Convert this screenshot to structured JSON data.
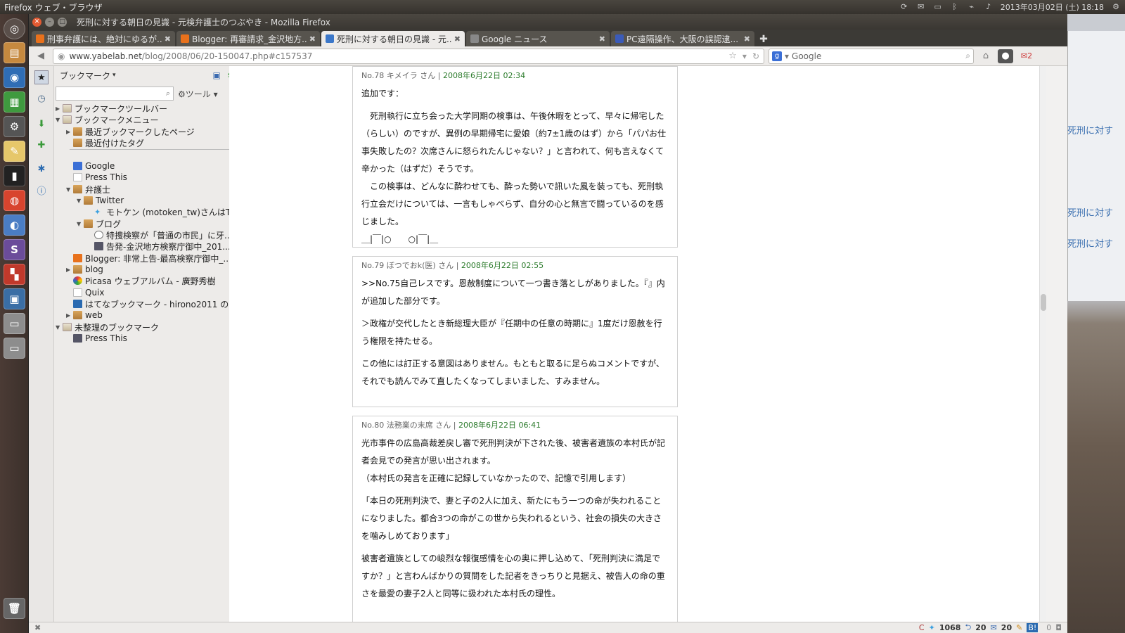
{
  "topbar": {
    "app_name": "Firefox ウェブ・ブラウザ",
    "datetime": "2013年03月02日 (土) 18:18"
  },
  "window": {
    "title": "死刑に対する朝日の見識 - 元検弁護士のつぶやき - Mozilla Firefox"
  },
  "tabs": [
    {
      "label": "刑事弁護には、絶対にゆるが...",
      "favicon_color": "#e8711c",
      "active": false
    },
    {
      "label": "Blogger: 再審請求_金沢地方...",
      "favicon_color": "#e8711c",
      "active": false
    },
    {
      "label": "死刑に対する朝日の見識 - 元...",
      "favicon_color": "#3b77c9",
      "active": true
    },
    {
      "label": "Google ニュース",
      "favicon_color": "#888888",
      "active": false
    },
    {
      "label": "PC遠隔操作、大阪の誤認逮...",
      "favicon_color": "#3b5bb9",
      "active": false
    }
  ],
  "navbar": {
    "url_site": "www.yabelab.net",
    "url_path": "/blog/2008/06/20-150047.php#c157537",
    "search_placeholder": "Google",
    "badge": "2"
  },
  "sidebar": {
    "title": "ブックマーク",
    "tools_label": "ツール",
    "tree": [
      {
        "label": "ブックマークツールバー",
        "indent": 0,
        "arrow": "▶",
        "icon": "folder-special"
      },
      {
        "label": "ブックマークメニュー",
        "indent": 0,
        "arrow": "▼",
        "icon": "folder-special"
      },
      {
        "label": "最近ブックマークしたページ",
        "indent": 1,
        "arrow": "▶",
        "icon": "folder"
      },
      {
        "label": "最近付けたタグ",
        "indent": 1,
        "arrow": "",
        "icon": "folder"
      },
      {
        "label": "Google",
        "indent": 1,
        "arrow": "",
        "icon": "google"
      },
      {
        "label": "Press This",
        "indent": 1,
        "arrow": "",
        "icon": "page"
      },
      {
        "label": "弁護士",
        "indent": 1,
        "arrow": "▼",
        "icon": "folder"
      },
      {
        "label": "Twitter",
        "indent": 2,
        "arrow": "▼",
        "icon": "folder"
      },
      {
        "label": "モトケン (motoken_tw)さんはT...",
        "indent": 3,
        "arrow": "",
        "icon": "twitter"
      },
      {
        "label": "ブログ",
        "indent": 2,
        "arrow": "▼",
        "icon": "folder"
      },
      {
        "label": "特捜検察が「普通の市民」に牙...",
        "indent": 3,
        "arrow": "",
        "icon": "wordpress"
      },
      {
        "label": "告発-金沢地方検察庁御中_201...",
        "indent": 3,
        "arrow": "",
        "icon": "image"
      },
      {
        "label": "Blogger: 非常上告-最高検察庁御中_...",
        "indent": 1,
        "arrow": "",
        "icon": "blogger"
      },
      {
        "label": "blog",
        "indent": 1,
        "arrow": "▶",
        "icon": "folder"
      },
      {
        "label": "Picasa ウェブアルバム - 廣野秀樹",
        "indent": 1,
        "arrow": "",
        "icon": "picasa"
      },
      {
        "label": "Quix",
        "indent": 1,
        "arrow": "",
        "icon": "page"
      },
      {
        "label": "はてなブックマーク - hirono2011 のブ...",
        "indent": 1,
        "arrow": "",
        "icon": "hatena"
      },
      {
        "label": "web",
        "indent": 1,
        "arrow": "▶",
        "icon": "folder"
      },
      {
        "label": "未整理のブックマーク",
        "indent": 0,
        "arrow": "▼",
        "icon": "folder-special"
      },
      {
        "label": "Press This",
        "indent": 1,
        "arrow": "",
        "icon": "image"
      }
    ]
  },
  "comments": [
    {
      "header": "No.78 キメイラ さん |",
      "date": "2008年6月22日 02:34",
      "paragraphs": [
        "追加です：",
        "　死刑執行に立ち会った大学同期の検事は、午後休暇をとって、早々に帰宅した（らしい）のですが、異例の早期帰宅に愛娘（約7±1歳のはず）から「パパお仕事失敗したの？次席さんに怒られたんじゃない？」と言われて、何も言えなくて辛かった（はずだ）そうです。",
        "　この検事は、どんなに酔わせても、酔った勢いで訊いた風を装っても、死刑執行立会だけについては、一言もしゃべらず、自分の心と無言で闘っているのを感じました。",
        "＿|￣|○　　○|￣|＿"
      ]
    },
    {
      "header": "No.79 ぼつでおk(医) さん |",
      "date": "2008年6月22日 02:55",
      "paragraphs": [
        ">>No.75自己レスです。恩赦制度について一つ書き落としがありました。『』内が追加した部分です。",
        "＞政権が交代したとき新総理大臣が『任期中の任意の時期に』1度だけ恩赦を行う権限を持たせる。",
        "この他には訂正する意図はありません。もともと取るに足らぬコメントですが、それでも読んでみて直したくなってしまいました、すみません。"
      ]
    },
    {
      "header": "No.80 法務業の末席 さん |",
      "date": "2008年6月22日 06:41",
      "paragraphs": [
        "光市事件の広島高裁差戻し審で死刑判決が下された後、被害者遺族の本村氏が記者会見での発言が思い出されます。\n（本村氏の発言を正確に記録していなかったので、記憶で引用します）",
        "「本日の死刑判決で、妻と子の2人に加え、新たにもう一つの命が失われることになりました。都合3つの命がこの世から失われるという、社会の損失の大きさを噛みしめております」",
        "被害者遺族としての峻烈な報復感情を心の奥に押し込めて、「死刑判決に満足ですか？」と言わんばかりの質問をした記者をきっちりと見据え、被告人の命の重さを最愛の妻子2人と同等に扱われた本村氏の理性。"
      ]
    }
  ],
  "statusbar": {
    "count1": "1068",
    "count2": "20",
    "count3": "20",
    "count4": "0"
  },
  "background_window": {
    "snippets": [
      "死刑に対す",
      "死刑に対す",
      "死刑に対す"
    ]
  }
}
